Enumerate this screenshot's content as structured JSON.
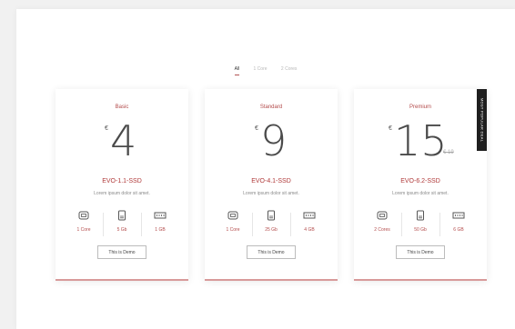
{
  "filters": [
    {
      "label": "All",
      "active": true
    },
    {
      "label": "1 Core",
      "active": false
    },
    {
      "label": "2 Cores",
      "active": false
    }
  ],
  "currency_symbol": "€",
  "plans": [
    {
      "name": "Basic",
      "price": "4",
      "title": "EVO-1.1-SSD",
      "description": "Lorem ipsum dolor sit amet.",
      "specs": [
        {
          "icon": "cpu-icon",
          "label": "1 Core"
        },
        {
          "icon": "storage-icon",
          "label": "5 Gb"
        },
        {
          "icon": "ram-icon",
          "label": "1 GB"
        }
      ],
      "button_label": "This is Demo"
    },
    {
      "name": "Standard",
      "price": "9",
      "title": "EVO-4.1-SSD",
      "description": "Lorem ipsum dolor sit amet.",
      "specs": [
        {
          "icon": "cpu-icon",
          "label": "1 Core"
        },
        {
          "icon": "storage-icon",
          "label": "25 Gb"
        },
        {
          "icon": "ram-icon",
          "label": "4 GB"
        }
      ],
      "button_label": "This is Demo"
    },
    {
      "name": "Premium",
      "price": "15",
      "old_price": "€ 19",
      "badge": "MOST POPULAR DEAL",
      "title": "EVO-6.2-SSD",
      "description": "Lorem ipsum dolor sit amet.",
      "specs": [
        {
          "icon": "cpu-icon",
          "label": "2 Cores"
        },
        {
          "icon": "storage-icon",
          "label": "50 Gb"
        },
        {
          "icon": "ram-icon",
          "label": "6 GB"
        }
      ],
      "button_label": "This is Demo"
    }
  ],
  "colors": {
    "accent": "#b34a4a",
    "card_border": "#d89a9a",
    "ribbon": "#1f1f1f"
  }
}
